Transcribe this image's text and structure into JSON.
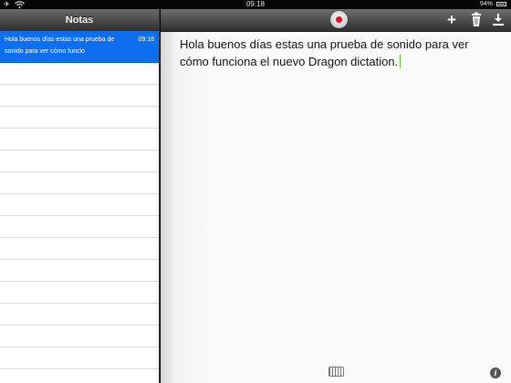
{
  "status_bar": {
    "time": "09:18",
    "battery_percent": "94%",
    "icons": [
      "airplane-icon",
      "wifi-icon",
      "battery-icon"
    ]
  },
  "sidebar": {
    "title": "Notas",
    "selected_note": {
      "preview": "Hola buenos días estas una prueba de sonido para ver cómo funcio",
      "time": "09:18"
    }
  },
  "toolbar": {
    "icons": [
      "record-icon",
      "add-icon",
      "trash-icon",
      "export-icon"
    ],
    "record_color": "#d4142a"
  },
  "note": {
    "text": "Hola buenos días estas una prueba de sonido para ver cómo funciona el nuevo Dragon dictation."
  },
  "footer": {
    "icons": [
      "keyboard-icon",
      "info-icon"
    ]
  },
  "colors": {
    "selection": "#0d6ff0",
    "cursor": "#59b52e"
  }
}
